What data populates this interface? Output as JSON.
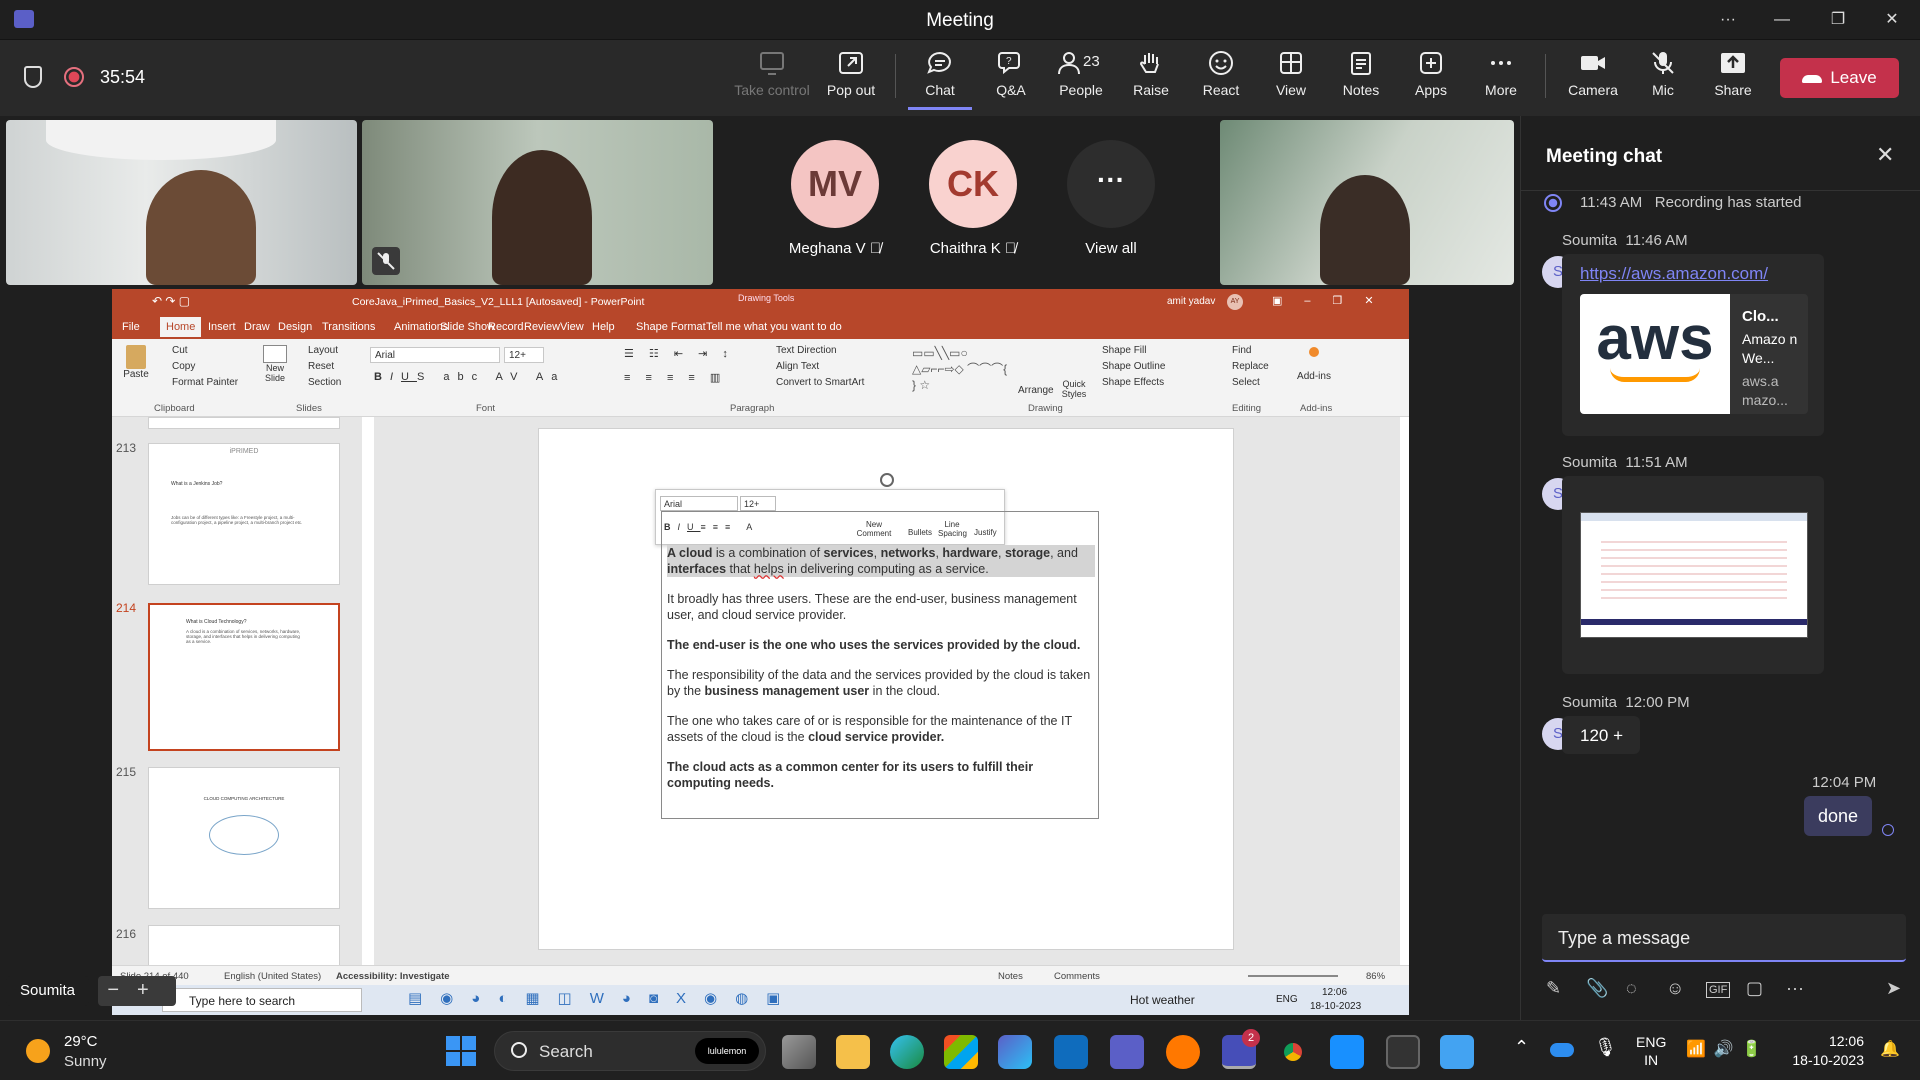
{
  "window": {
    "title": "Meeting"
  },
  "meeting": {
    "timer": "35:54"
  },
  "toolbar": {
    "take_control": "Take control",
    "pop_out": "Pop out",
    "chat": "Chat",
    "qa": "Q&A",
    "people": "People",
    "people_count": "23",
    "raise": "Raise",
    "react": "React",
    "view": "View",
    "notes": "Notes",
    "apps": "Apps",
    "more": "More",
    "camera": "Camera",
    "mic": "Mic",
    "share": "Share",
    "leave": "Leave"
  },
  "participants": {
    "p1_initials": "MV",
    "p1_name": "Meghana V",
    "p1_color": "#f4c5c3",
    "p2_initials": "CK",
    "p2_name": "Chaithra K",
    "p2_color": "#f9d2cf",
    "view_all": "View all",
    "presenter_name": "Soumita"
  },
  "ppt": {
    "title": "CoreJava_iPrimed_Basics_V2_LLL1 [Autosaved] - PowerPoint",
    "context_tab": "Drawing Tools",
    "user": "amit yadav",
    "user_initials": "AY",
    "tabs": [
      "File",
      "Home",
      "Insert",
      "Draw",
      "Design",
      "Transitions",
      "Animations",
      "Slide Show",
      "Record",
      "Review",
      "View",
      "Help",
      "Shape Format"
    ],
    "tell_me": "Tell me what you want to do",
    "ribbon": {
      "paste": "Paste",
      "cut": "Cut",
      "copy": "Copy",
      "format_painter": "Format Painter",
      "new_slide": "New Slide",
      "layout": "Layout",
      "reset": "Reset",
      "section": "Section",
      "font": "Arial",
      "font_size": "12+",
      "text_direction": "Text Direction",
      "align_text": "Align Text",
      "convert_smartart": "Convert to SmartArt",
      "arrange": "Arrange",
      "quick_styles": "Quick Styles",
      "shape_fill": "Shape Fill",
      "shape_outline": "Shape Outline",
      "shape_effects": "Shape Effects",
      "find": "Find",
      "replace": "Replace",
      "select": "Select",
      "addins": "Add-ins",
      "groups": {
        "clipboard": "Clipboard",
        "slides": "Slides",
        "font": "Font",
        "paragraph": "Paragraph",
        "drawing": "Drawing",
        "editing": "Editing",
        "addins": "Add-ins"
      }
    },
    "thumbs": [
      {
        "num": "213",
        "head": "iPRIMED",
        "line1": "What is a Jenkins Job?",
        "line2": "Jobs can be of different types like: a Freestyle project, a multi-configuration project, a pipeline project, a multi-branch project etc."
      },
      {
        "num": "214",
        "head": "",
        "line1": "What is Cloud Technology?",
        "line2": "A cloud is a combination of services, networks, hardware, storage, and interfaces that helps in delivering computing as a service."
      },
      {
        "num": "215",
        "head": "CLOUD COMPUTING ARCHITECTURE",
        "line1": "",
        "line2": ""
      },
      {
        "num": "216",
        "head": "",
        "line1": "",
        "line2": ""
      }
    ],
    "minitoolbar": {
      "font": "Arial",
      "size": "12+",
      "new_comment": "New Comment",
      "bullets": "Bullets",
      "line_spacing": "Line Spacing",
      "justify": "Justify"
    },
    "slide": {
      "p1_a": "A cloud",
      "p1_b": " is a combination of ",
      "p1_c": "services",
      "p1_d": ", ",
      "p1_e": "networks",
      "p1_f": ", ",
      "p1_g": "hardware",
      "p1_h": ", ",
      "p1_i": "storage",
      "p1_j": ", and ",
      "p1_k": "interfaces",
      "p1_l": " that ",
      "p1_m": "helps",
      "p1_n": " in delivering computing as a service.",
      "p2": "It broadly has three users. These are the end-user, business management user, and cloud service provider.",
      "p3": "The end-user is the one who uses the services provided by the cloud.",
      "p4_a": "The responsibility of the data and the services provided by the cloud is taken by the ",
      "p4_b": "business management user",
      "p4_c": " in the cloud.",
      "p5_a": "The one who takes care of or is responsible for the maintenance of the IT assets of the cloud is the ",
      "p5_b": "cloud service provider.",
      "p6": "The cloud acts as a common center for its users to fulfill their computing needs."
    },
    "status": {
      "slide_count": "Slide 214 of 440",
      "language": "English (United States)",
      "accessibility": "Accessibility: Investigate",
      "notes": "Notes",
      "comments": "Comments",
      "zoom": "86%"
    },
    "inner_taskbar": {
      "search": "Type here to search",
      "weather": "Hot weather",
      "lang": "ENG",
      "time": "12:06",
      "date": "18-10-2023"
    }
  },
  "chat": {
    "title": "Meeting chat",
    "system_time": "11:43 AM",
    "system_msg": "Recording has started",
    "m1_sender": "Soumita",
    "m1_time": "11:46 AM",
    "m1_link": "https://aws.amazon.com/",
    "m1_card_title": "Clo...",
    "m1_card_body": "Amazo n We...",
    "m1_card_domain": "aws.a mazo...",
    "m1_logo": "aws",
    "m2_sender": "Soumita",
    "m2_time": "11:51 AM",
    "m3_sender": "Soumita",
    "m3_time": "12:00 PM",
    "m3_text": "120 +",
    "avatar_initial": "S",
    "my_time": "12:04 PM",
    "my_text": "done",
    "compose_placeholder": "Type a message"
  },
  "weather": {
    "temp": "29°C",
    "condition": "Sunny"
  },
  "taskbar": {
    "search": "Search",
    "lululemon": "lululemon",
    "lang1": "ENG",
    "lang2": "IN",
    "time": "12:06",
    "date": "18-10-2023",
    "teams_badge": "2"
  }
}
